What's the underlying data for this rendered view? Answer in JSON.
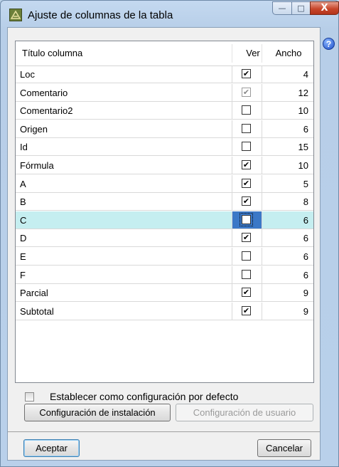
{
  "window": {
    "title": "Ajuste de columnas de la tabla",
    "minimize_glyph": "—",
    "maximize_glyph": "□",
    "close_glyph": "X",
    "help_glyph": "?"
  },
  "grid": {
    "headers": {
      "title": "Título columna",
      "ver": "Ver",
      "ancho": "Ancho"
    },
    "rows": [
      {
        "name": "Loc",
        "ver": true,
        "ancho": "4",
        "disabled": false
      },
      {
        "name": "Comentario",
        "ver": true,
        "ancho": "12",
        "disabled": true
      },
      {
        "name": "Comentario2",
        "ver": false,
        "ancho": "10",
        "disabled": false
      },
      {
        "name": "Origen",
        "ver": false,
        "ancho": "6",
        "disabled": false
      },
      {
        "name": "Id",
        "ver": false,
        "ancho": "15",
        "disabled": false
      },
      {
        "name": "Fórmula",
        "ver": true,
        "ancho": "10",
        "disabled": false
      },
      {
        "name": "A",
        "ver": true,
        "ancho": "5",
        "disabled": false
      },
      {
        "name": "B",
        "ver": true,
        "ancho": "8",
        "disabled": false
      },
      {
        "name": "C",
        "ver": false,
        "ancho": "6",
        "disabled": false,
        "selected": true
      },
      {
        "name": "D",
        "ver": true,
        "ancho": "6",
        "disabled": false
      },
      {
        "name": "E",
        "ver": false,
        "ancho": "6",
        "disabled": false
      },
      {
        "name": "F",
        "ver": false,
        "ancho": "6",
        "disabled": false
      },
      {
        "name": "Parcial",
        "ver": true,
        "ancho": "9",
        "disabled": false
      },
      {
        "name": "Subtotal",
        "ver": true,
        "ancho": "9",
        "disabled": false
      }
    ],
    "check_glyph": "✔"
  },
  "options": {
    "default_config_label": "Establecer como configuración por defecto",
    "default_config_checked": false
  },
  "buttons": {
    "install_config": "Configuración de instalación",
    "user_config": "Configuración de usuario",
    "accept": "Aceptar",
    "cancel": "Cancelar"
  },
  "colors": {
    "selected_row": "#c5eef0",
    "focus_cell": "#3b78c7",
    "close_button": "#c8472b"
  }
}
